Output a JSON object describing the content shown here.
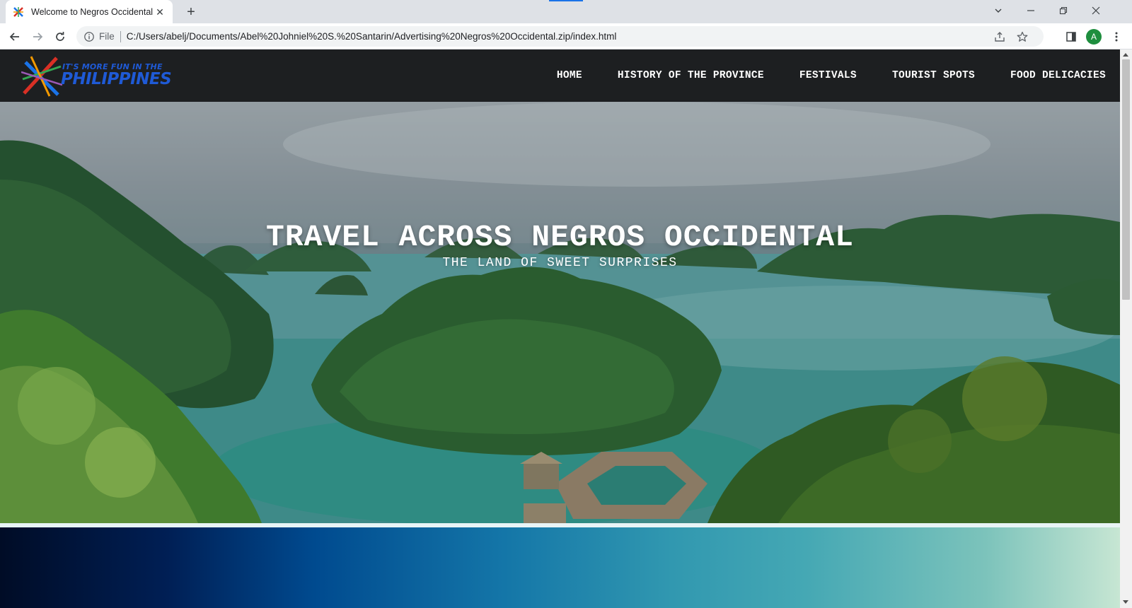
{
  "browser": {
    "tab_title": "Welcome to Negros Occidental",
    "scheme_label": "File",
    "url": "C:/Users/abelj/Documents/Abel%20Johniel%20S.%20Santarin/Advertising%20Negros%20Occidental.zip/index.html",
    "avatar_letter": "A",
    "new_tab_symbol": "+",
    "close_symbol": "✕"
  },
  "site": {
    "logo": {
      "line1": "IT'S MORE FUN IN THE",
      "line2": "PHILIPPINES"
    },
    "menu": [
      {
        "label": "HOME"
      },
      {
        "label": "HISTORY OF THE PROVINCE"
      },
      {
        "label": "FESTIVALS"
      },
      {
        "label": "TOURIST SPOTS"
      },
      {
        "label": "FOOD DELICACIES"
      }
    ],
    "hero": {
      "title": "TRAVEL ACROSS NEGROS OCCIDENTAL",
      "subtitle": "THE LAND OF SWEET SURPRISES"
    }
  },
  "colors": {
    "nav_bg": "#1d1f21",
    "logo_blue": "#1f5ad6",
    "chrome_bg": "#dee1e6",
    "avatar_bg": "#1e8e3e"
  }
}
